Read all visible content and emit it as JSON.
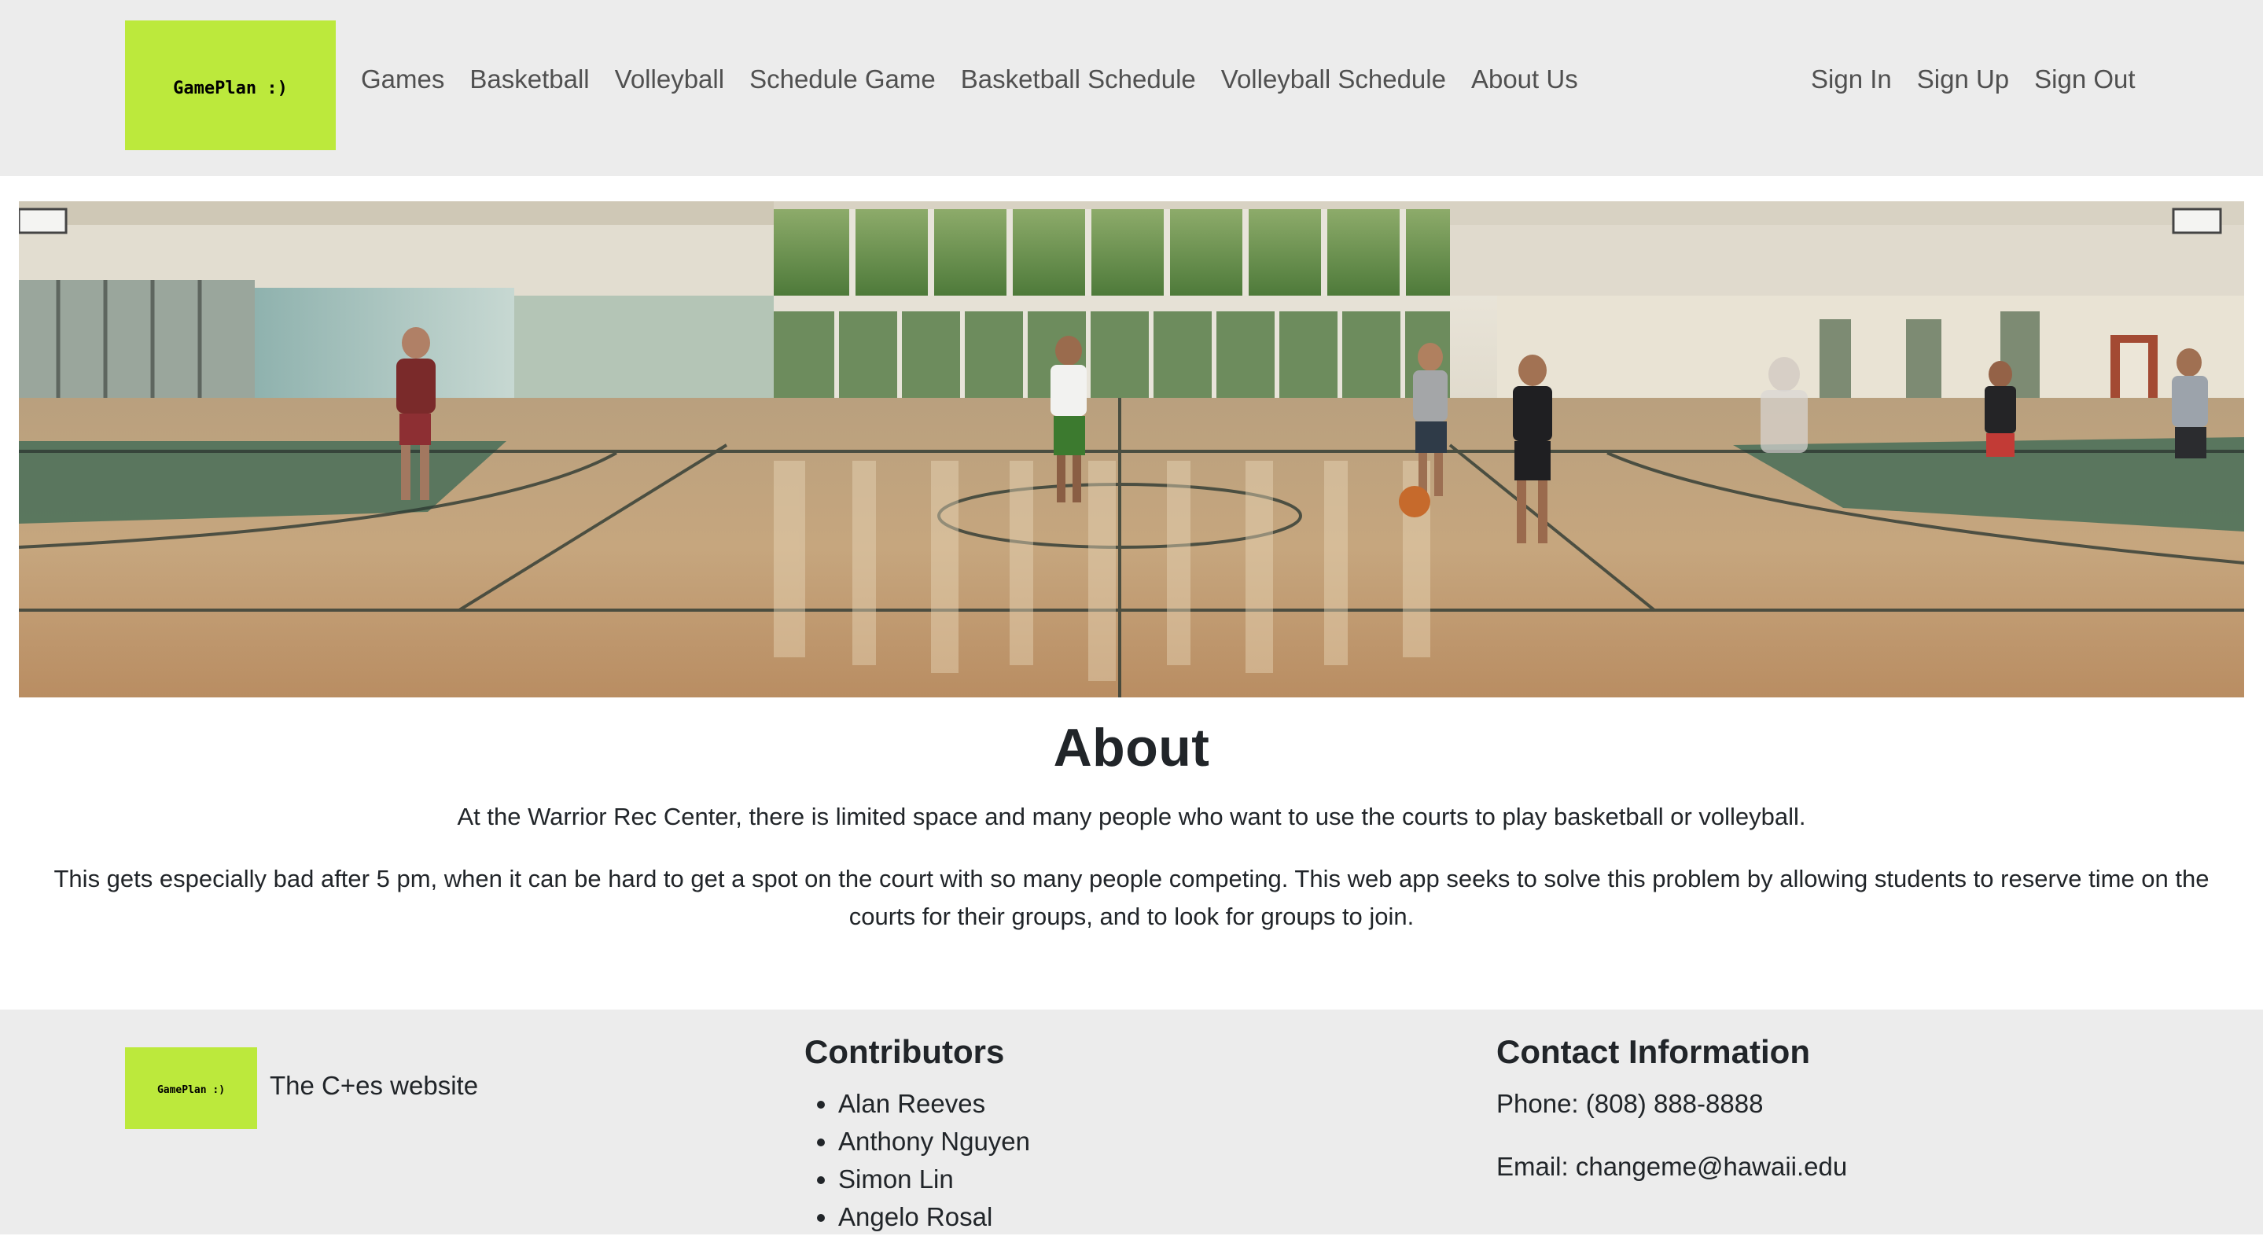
{
  "navbar": {
    "logo_text": "GamePlan :)",
    "links": [
      "Games",
      "Basketball",
      "Volleyball",
      "Schedule Game",
      "Basketball Schedule",
      "Volleyball Schedule",
      "About Us"
    ],
    "auth_links": [
      "Sign In",
      "Sign Up",
      "Sign Out"
    ],
    "logo_color": "#bce93c"
  },
  "about": {
    "title": "About",
    "paragraph1": "At the Warrior Rec Center, there is limited space and many people who want to use the courts to play basketball or volleyball.",
    "paragraph2": "This gets especially bad after 5 pm, when it can be hard to get a spot on the court with so many people competing. This web app seeks to solve this problem by allowing students to reserve time on the courts for their groups, and to look for groups to join."
  },
  "footer": {
    "logo_text": "GamePlan :)",
    "tagline": "The C+es website",
    "contributors_title": "Contributors",
    "contributors": [
      "Alan Reeves",
      "Anthony Nguyen",
      "Simon Lin",
      "Angelo Rosal"
    ],
    "contact_title": "Contact Information",
    "phone": "Phone: (808) 888-8888",
    "email": "Email: changeme@hawaii.edu"
  }
}
